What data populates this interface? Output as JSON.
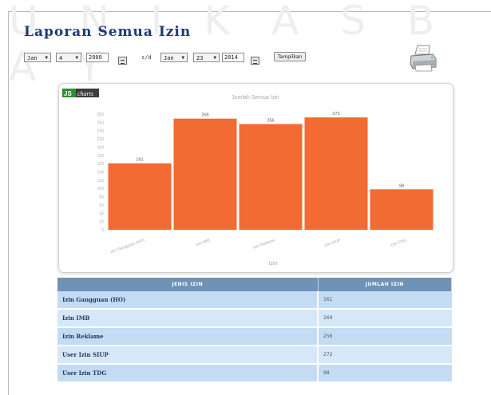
{
  "watermark": "U N I K A S B A Y",
  "page": {
    "title": "Laporan Semua Izin"
  },
  "filter": {
    "from": {
      "month": "Jan",
      "day": "4",
      "year": "2000"
    },
    "separator": "s/d",
    "to": {
      "month": "Jan",
      "day": "23",
      "year": "2014"
    },
    "submit_label": "Tampilkan"
  },
  "chart": {
    "brand_js": "JS",
    "brand_charts": "charts",
    "bar_color": "#f26b32"
  },
  "chart_data": {
    "type": "bar",
    "title": "Jumlah Semua Izin",
    "xlabel": "Izin",
    "ylabel": "",
    "categories": [
      "Izin Gangguan (HO)",
      "Izin IMB",
      "Izin Reklame",
      "Izin SIUP",
      "Izin TDG"
    ],
    "values": [
      161,
      269,
      256,
      272,
      98
    ],
    "ylim": [
      0,
      280
    ],
    "yticks": [
      0,
      20,
      40,
      60,
      80,
      100,
      120,
      140,
      160,
      180,
      200,
      220,
      240,
      260,
      280
    ],
    "grid": false,
    "legend": "none"
  },
  "table": {
    "headers": [
      "JENIS IZIN",
      "JUMLAH IZIN"
    ],
    "rows": [
      {
        "jenis": "Izin Gangguan (HO)",
        "jumlah": "161"
      },
      {
        "jenis": "Izin IMB",
        "jumlah": "269"
      },
      {
        "jenis": "Izin Reklame",
        "jumlah": "256"
      },
      {
        "jenis": "User Izin SIUP",
        "jumlah": "272"
      },
      {
        "jenis": "User Izin TDG",
        "jumlah": "98"
      }
    ]
  }
}
